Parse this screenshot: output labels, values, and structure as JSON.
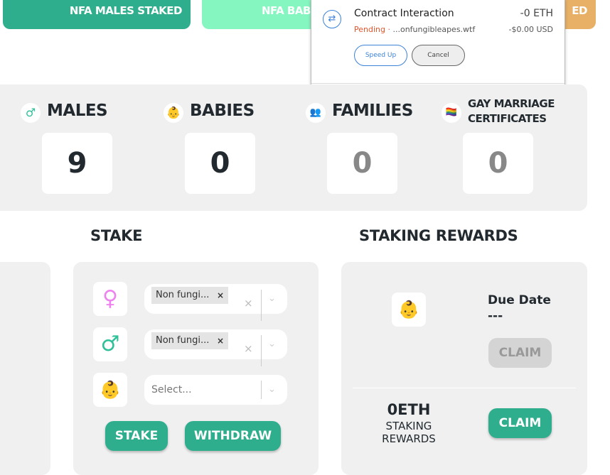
{
  "top_cards": [
    {
      "label": "NFA MALES STAKED",
      "color": "#2fae8e"
    },
    {
      "label": "NFA BAB",
      "color": "#86f6c0"
    },
    {
      "label": "ED",
      "color": "#e8b066"
    }
  ],
  "popup": {
    "title": "Contract Interaction",
    "amount": "-0 ETH",
    "status": "Pending",
    "separator": " · ",
    "origin": "...onfungibleapes.wtf",
    "usd": "-$0.00 USD",
    "speed_up": "Speed Up",
    "cancel": "Cancel"
  },
  "stats": [
    {
      "label": "MALES",
      "value": "9",
      "icon": "male-icon"
    },
    {
      "label": "BABIES",
      "value": "0",
      "icon": "baby-icon"
    },
    {
      "label": "FAMILIES",
      "value": "0",
      "icon": "family-icon"
    },
    {
      "label": "GAY MARRIAGE CERTIFICATES",
      "value": "0",
      "icon": "rainbow-flag-icon"
    }
  ],
  "stake": {
    "title": "STAKE",
    "female_select": "Non fungi...",
    "male_select": "Non fungi...",
    "baby_placeholder": "Select...",
    "stake_button": "STAKE",
    "withdraw_button": "WITHDRAW"
  },
  "rewards": {
    "title": "STAKING REWARDS",
    "due_date_label": "Due Date",
    "due_date_value": "---",
    "claim_disabled": "CLAIM",
    "amount": "0ETH",
    "amount_label": "STAKING REWARDS",
    "claim": "CLAIM"
  },
  "colors": {
    "accent": "#2fae8e",
    "pending": "#e5542b",
    "link": "#3b82d8"
  }
}
